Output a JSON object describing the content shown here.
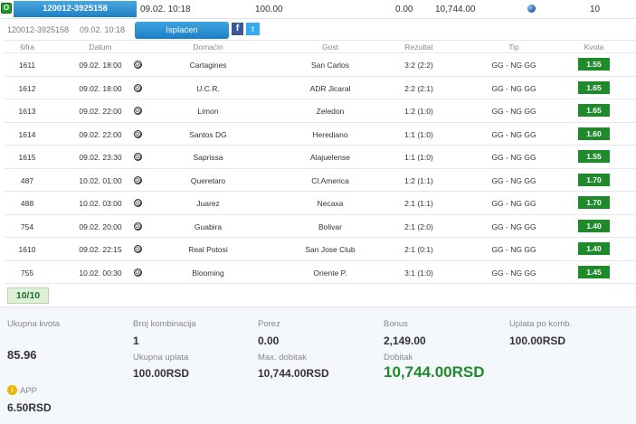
{
  "ticket": {
    "check_label": "O",
    "id": "120012-3925158",
    "date": "09.02. 10:18",
    "amount": "100.00",
    "zero": "0.00",
    "win": "10,744.00",
    "count": "10"
  },
  "sub": {
    "id": "120012-3925158",
    "date": "09.02. 10:18",
    "status_label": "Isplaćen",
    "facebook_label": "f",
    "twitter_label": "t"
  },
  "columns": {
    "sifra": "šifra",
    "datum": "Datum",
    "domacin": "Domaćin",
    "gost": "Gost",
    "rezultat": "Rezultat",
    "tip": "Tip",
    "kvota": "Kvota"
  },
  "rows": [
    {
      "sifra": "1611",
      "datum": "09.02. 18:00",
      "home": "Cartagines",
      "away": "San Carlos",
      "result": "3:2 (2:2)",
      "tip": "GG - NG GG",
      "kvota": "1.55"
    },
    {
      "sifra": "1612",
      "datum": "09.02. 18:00",
      "home": "U.C.R.",
      "away": "ADR Jicaral",
      "result": "2:2 (2:1)",
      "tip": "GG - NG GG",
      "kvota": "1.65"
    },
    {
      "sifra": "1613",
      "datum": "09.02. 22:00",
      "home": "Limon",
      "away": "Zeledon",
      "result": "1:2 (1:0)",
      "tip": "GG - NG GG",
      "kvota": "1.65"
    },
    {
      "sifra": "1614",
      "datum": "09.02. 22:00",
      "home": "Santos DG",
      "away": "Herediano",
      "result": "1:1 (1:0)",
      "tip": "GG - NG GG",
      "kvota": "1.60"
    },
    {
      "sifra": "1615",
      "datum": "09.02. 23:30",
      "home": "Saprissa",
      "away": "Alajuelense",
      "result": "1:1 (1:0)",
      "tip": "GG - NG GG",
      "kvota": "1.55"
    },
    {
      "sifra": "487",
      "datum": "10.02. 01:00",
      "home": "Queretaro",
      "away": "Cl.America",
      "result": "1:2 (1:1)",
      "tip": "GG - NG GG",
      "kvota": "1.70"
    },
    {
      "sifra": "488",
      "datum": "10.02. 03:00",
      "home": "Juarez",
      "away": "Necaxa",
      "result": "2:1 (1:1)",
      "tip": "GG - NG GG",
      "kvota": "1.70"
    },
    {
      "sifra": "754",
      "datum": "09.02. 20:00",
      "home": "Guabira",
      "away": "Bolivar",
      "result": "2:1 (2:0)",
      "tip": "GG - NG GG",
      "kvota": "1.40"
    },
    {
      "sifra": "1610",
      "datum": "09.02. 22:15",
      "home": "Real Potosi",
      "away": "San Jose Club",
      "result": "2:1 (0:1)",
      "tip": "GG - NG GG",
      "kvota": "1.40"
    },
    {
      "sifra": "755",
      "datum": "10.02. 00:30",
      "home": "Blooming",
      "away": "Oriente P.",
      "result": "3:1 (1:0)",
      "tip": "GG - NG GG",
      "kvota": "1.45"
    }
  ],
  "counter": "10/10",
  "summary": {
    "ukupna_kvota_label": "Ukupna kvota",
    "ukupna_kvota": "85.96",
    "app_label": "APP",
    "app_value": "6.50RSD",
    "broj_kombinacija_label": "Broj kombinacija",
    "broj_kombinacija": "1",
    "ukupna_uplata_label": "Ukupna uplata",
    "ukupna_uplata": "100.00RSD",
    "porez_label": "Porez",
    "porez": "0.00",
    "max_dobitak_label": "Max. dobitak",
    "max_dobitak": "10,744.00RSD",
    "bonus_label": "Bonus",
    "bonus": "2,149.00",
    "dobitak_label": "Dobitak",
    "dobitak": "10,744.00RSD",
    "uplata_po_komb_label": "Uplata po komb.",
    "uplata_po_komb": "100.00RSD",
    "info_icon_label": "i"
  },
  "colors": {
    "accent_blue": "#1f7fc4",
    "odds_green": "#1e8a2a",
    "win_green": "#1e8a2a"
  }
}
